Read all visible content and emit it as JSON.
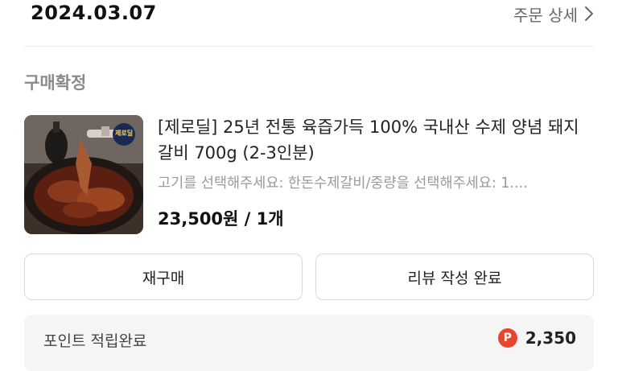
{
  "order": {
    "date": "2024.03.07",
    "detail_link": "주문 상세",
    "status": "구매확정"
  },
  "product": {
    "name": "[제로딜] 25년 전통 육즙가득 100% 국내산 수제 양념 돼지 갈비 700g (2-3인분)",
    "option": "고기를 선택해주세요: 한돈수제갈비/중량을 선택해주세요: 1....",
    "price": "23,500원 / 1개",
    "badge_text": "제로딜"
  },
  "actions": {
    "rebuy_label": "재구매",
    "review_label": "리뷰 작성 완료"
  },
  "points": {
    "label": "포인트 적립완료",
    "icon_letter": "P",
    "value": "2,350"
  },
  "icons": {
    "detail_arrow": "chevron-right-icon",
    "points": "point-coin-icon"
  },
  "colors": {
    "points_icon": "#e8442e",
    "status_text": "#8a8a8a",
    "points_bg": "#f5f5f5"
  }
}
